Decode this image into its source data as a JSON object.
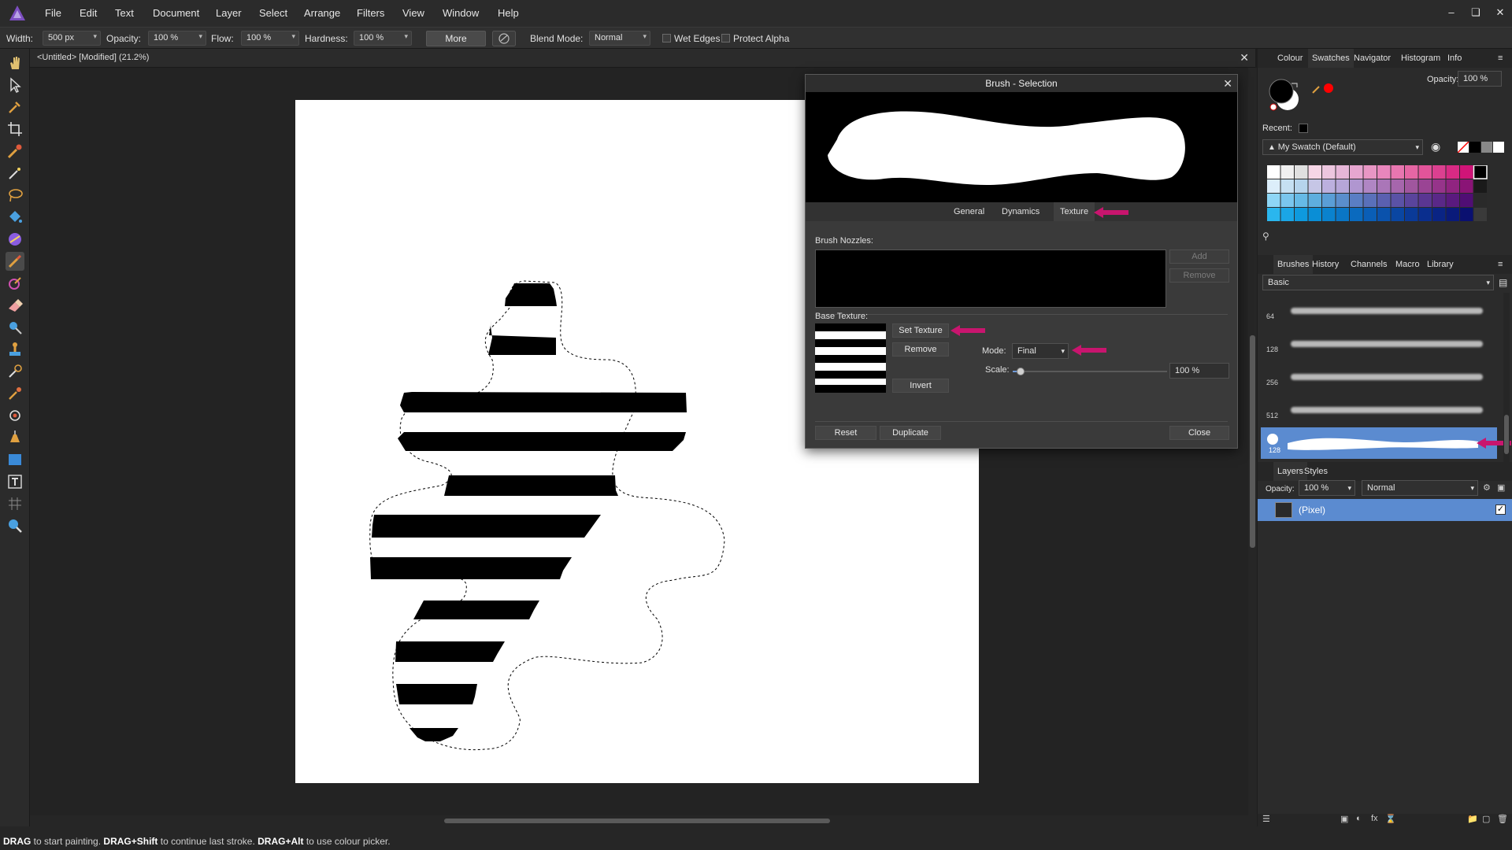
{
  "menu": {
    "items": [
      "File",
      "Edit",
      "Text",
      "Document",
      "Layer",
      "Select",
      "Arrange",
      "Filters",
      "View",
      "Window",
      "Help"
    ]
  },
  "context_toolbar": {
    "width_label": "Width:",
    "width_value": "500 px",
    "opacity_label": "Opacity:",
    "opacity_value": "100 %",
    "flow_label": "Flow:",
    "flow_value": "100 %",
    "hardness_label": "Hardness:",
    "hardness_value": "100 %",
    "more_label": "More",
    "blend_label": "Blend Mode:",
    "blend_value": "Normal",
    "wet_edges_label": "Wet Edges",
    "protect_alpha_label": "Protect Alpha"
  },
  "document": {
    "tab_title": "<Untitled> [Modified] (21.2%)"
  },
  "dialog": {
    "title": "Brush - Selection",
    "tabs": [
      "General",
      "Dynamics",
      "Texture"
    ],
    "active_tab": "Texture",
    "nozzles_label": "Brush Nozzles:",
    "add_label": "Add",
    "remove_nozzle_label": "Remove",
    "base_texture_label": "Base Texture:",
    "set_texture_label": "Set Texture",
    "remove_texture_label": "Remove",
    "invert_label": "Invert",
    "mode_label": "Mode:",
    "mode_value": "Final",
    "scale_label": "Scale:",
    "scale_value": "100 %",
    "scale_level": 0.05,
    "reset_label": "Reset",
    "duplicate_label": "Duplicate",
    "close_label": "Close"
  },
  "colour_panel": {
    "tabs": [
      "Colour",
      "Swatches",
      "Navigator",
      "Histogram",
      "Info"
    ],
    "active_tab": "Swatches",
    "opacity_label": "Opacity:",
    "opacity_value": "100 %",
    "recent_label": "Recent:",
    "palette_value": "My Swatch (Default)"
  },
  "brushes_panel": {
    "tabs": [
      "Brushes",
      "History",
      "Channels",
      "Macro",
      "Library"
    ],
    "active_tab": "Brushes",
    "category": "Basic",
    "brush_sizes": [
      "64",
      "128",
      "256",
      "512",
      "128"
    ],
    "selected_index": 4
  },
  "layers_panel": {
    "tabs": [
      "Layers",
      "Styles"
    ],
    "active_tab": "Layers",
    "opacity_label": "Opacity:",
    "opacity_value": "100 %",
    "blend_value": "Normal",
    "layer_name": "(Pixel)"
  },
  "status": {
    "part1_key": "DRAG",
    "part1_text": " to start painting. ",
    "part2_key": "DRAG+Shift",
    "part2_text": " to continue last stroke. ",
    "part3_key": "DRAG+Alt",
    "part3_text": " to use colour picker."
  },
  "colors": {
    "accent": "#5b8bd0",
    "annotation_arrow": "#c8156e",
    "brand": "#7d4fc1"
  }
}
